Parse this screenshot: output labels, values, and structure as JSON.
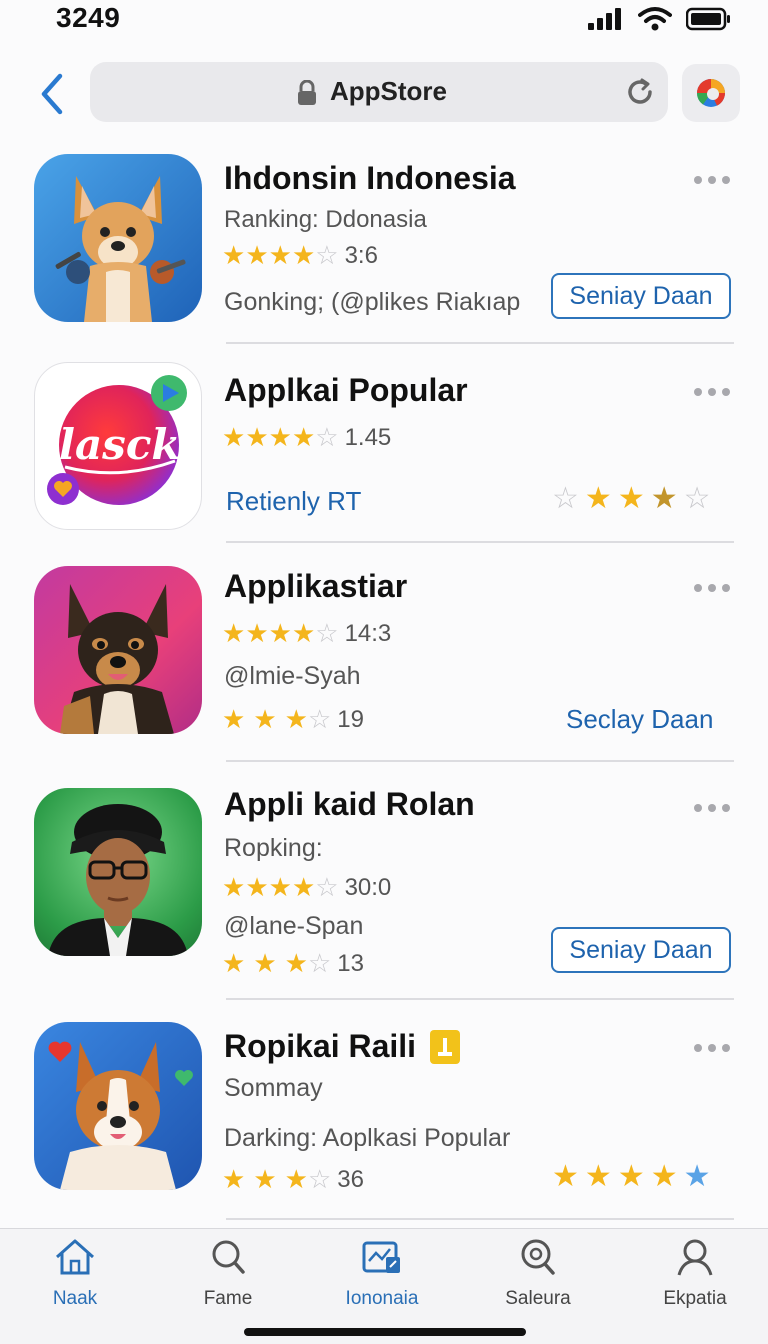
{
  "status_bar": {
    "time": "3249"
  },
  "browser": {
    "url": "AppStore"
  },
  "apps": [
    {
      "title": "Ihdonsin Indonesia",
      "subtitle": "Ranking: Ddonasia",
      "rating": 4,
      "rating_value": "3:6",
      "line2": "Gonking; (@plikes Riakıap",
      "button_label": "Seniay Daan"
    },
    {
      "title": "Applkai Popular",
      "icon_text": "lasck",
      "rating": 4,
      "rating_value": "1.45",
      "link_label": "Retienly RT",
      "right_rating": 3.5
    },
    {
      "title": "Applikastiar",
      "rating": 4,
      "rating_value": "14:3",
      "subtitle": "@lmie-Syah",
      "rating2": 3,
      "rating2_value": "19",
      "link_label": "Seclay Daan"
    },
    {
      "title": "Appli kaid  Rolan",
      "subtitle": "Ropking:",
      "rating": 4,
      "rating_value": "30:0",
      "line2": "@lane-Span",
      "rating2": 3,
      "rating2_value": "13",
      "button_label": "Seniay Daan"
    },
    {
      "title": "Ropikai Raili",
      "subtitle": "Sommay",
      "line2": "Darking: Aoplkasi Popular",
      "rating": 3,
      "rating_value": "36",
      "right_rating": 5
    }
  ],
  "tabs": [
    {
      "label": "Naak",
      "icon": "home-icon",
      "active": true
    },
    {
      "label": "Fame",
      "icon": "search-icon",
      "active": false
    },
    {
      "label": "Iononaia",
      "icon": "chart-icon",
      "active": true
    },
    {
      "label": "Saleura",
      "icon": "at-search-icon",
      "active": false
    },
    {
      "label": "Ekpatia",
      "icon": "person-icon",
      "active": false
    }
  ],
  "colors": {
    "accent": "#2a6fb6",
    "star": "#f4b51c"
  }
}
